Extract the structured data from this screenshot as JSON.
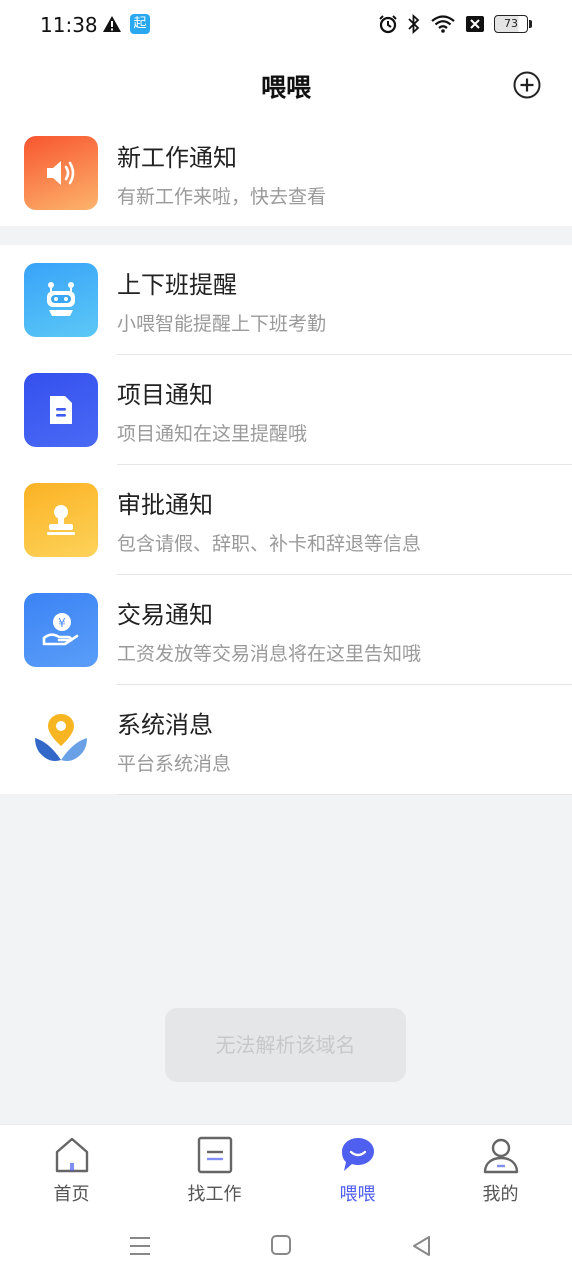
{
  "status_bar": {
    "time": "11:38",
    "app_badge": "起",
    "battery": "73",
    "icons": [
      "warning-icon",
      "app-badge-icon",
      "alarm-icon",
      "bluetooth-icon",
      "wifi-icon",
      "sim-icon",
      "battery-icon"
    ]
  },
  "header": {
    "title": "喂喂"
  },
  "notifications": [
    {
      "title": "新工作通知",
      "subtitle": "有新工作来啦，快去查看",
      "icon": "speaker-icon",
      "color": "#f9732f"
    },
    {
      "title": "上下班提醒",
      "subtitle": "小喂智能提醒上下班考勤",
      "icon": "robot-icon",
      "color": "#3aa7f4"
    },
    {
      "title": "项目通知",
      "subtitle": "项目通知在这里提醒哦",
      "icon": "document-icon",
      "color": "#3f5bf0"
    },
    {
      "title": "审批通知",
      "subtitle": "包含请假、辞职、补卡和辞退等信息",
      "icon": "stamp-icon",
      "color": "#fbbf2c"
    },
    {
      "title": "交易通知",
      "subtitle": "工资发放等交易消息将在这里告知哦",
      "icon": "money-hand-icon",
      "color": "#4f8ef7"
    },
    {
      "title": "系统消息",
      "subtitle": "平台系统消息",
      "icon": "location-logo-icon",
      "color": "#3f6fcf"
    }
  ],
  "toast": {
    "message": "无法解析该域名"
  },
  "tabbar": {
    "tabs": [
      {
        "label": "首页",
        "icon": "home-icon",
        "active": false
      },
      {
        "label": "找工作",
        "icon": "job-list-icon",
        "active": false
      },
      {
        "label": "喂喂",
        "icon": "chat-bubble-icon",
        "active": true
      },
      {
        "label": "我的",
        "icon": "profile-icon",
        "active": false
      }
    ],
    "active_color": "#4f5ff0"
  },
  "system_nav": {
    "icons": [
      "menu-icon",
      "home-square-icon",
      "back-icon"
    ]
  }
}
